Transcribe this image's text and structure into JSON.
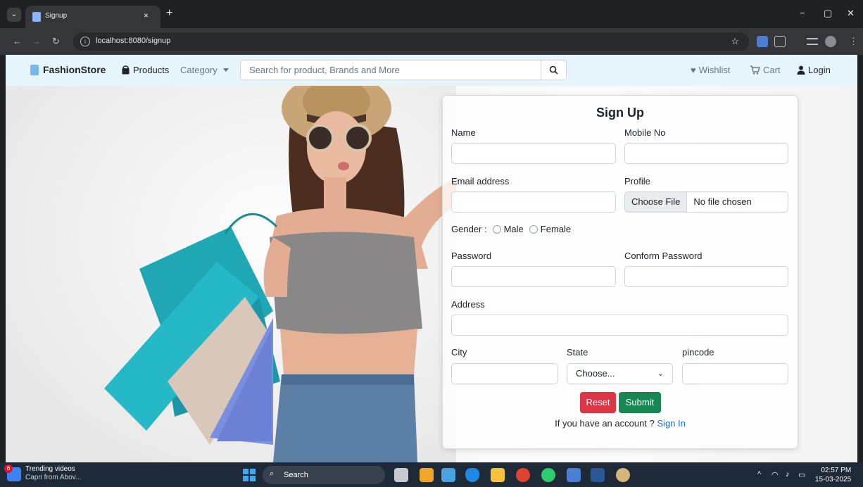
{
  "browser": {
    "tab_title": "Signup",
    "tab_close": "×",
    "new_tab": "+",
    "url": "localhost:8080/signup",
    "window_controls": {
      "minimize": "−",
      "maximize": "▢",
      "close": "✕"
    }
  },
  "navbar": {
    "brand": "FashionStore",
    "products": "Products",
    "category": "Category",
    "search_placeholder": "Search for product, Brands and More",
    "wishlist": "Wishlist",
    "cart": "Cart",
    "login": "Login"
  },
  "form": {
    "title": "Sign Up",
    "name_label": "Name",
    "mobile_label": "Mobile No",
    "email_label": "Email address",
    "profile_label": "Profile",
    "file_button": "Choose File",
    "file_status": "No file chosen",
    "gender_label": "Gender :",
    "gender_male": "Male",
    "gender_female": "Female",
    "password_label": "Password",
    "confirm_label": "Conform Password",
    "address_label": "Address",
    "city_label": "City",
    "state_label": "State",
    "pincode_label": "pincode",
    "state_selected": "Choose...",
    "reset_button": "Reset",
    "submit_button": "Submit",
    "account_text": "If you have an account ? ",
    "signin_link": "Sign In"
  },
  "taskbar": {
    "news_title": "Trending videos",
    "news_sub": "Capri from Abov...",
    "news_badge": "6",
    "search": "Search",
    "time": "02:57 PM",
    "date": "15-03-2025"
  },
  "colors": {
    "navbar_bg": "#e6f5fc",
    "reset": "#dc3545",
    "submit": "#198754",
    "link": "#0d6efd"
  }
}
